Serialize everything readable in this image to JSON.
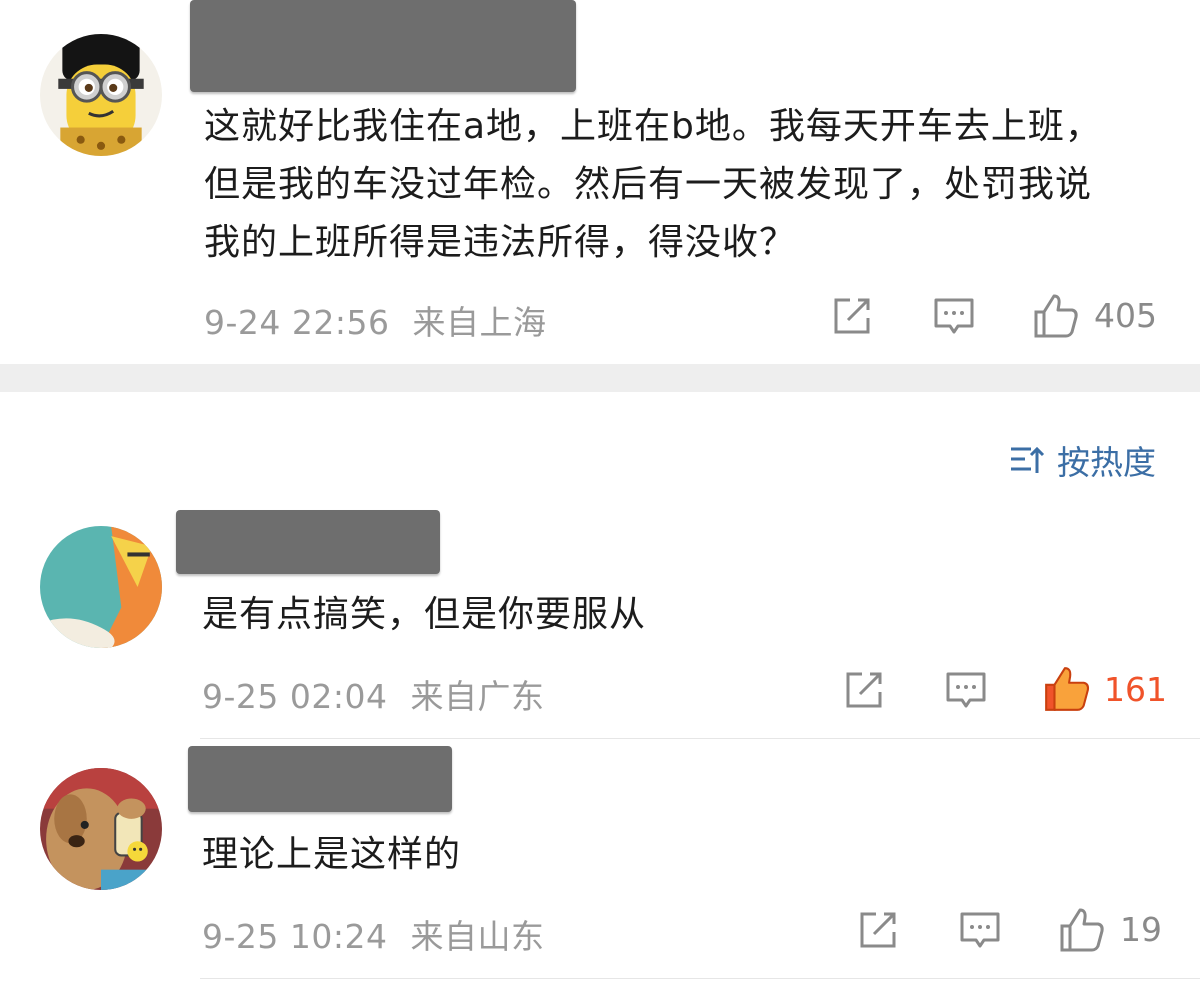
{
  "comments": [
    {
      "text": "这就好比我住在a地，上班在b地。我每天开车去上班，但是我的车没过年检。然后有一天被发现了，处罚我说我的上班所得是违法所得，得没收？",
      "time": "9-24 22:56",
      "location": "来自上海",
      "likes": "405",
      "liked": false
    },
    {
      "text": "是有点搞笑，但是你要服从",
      "time": "9-25 02:04",
      "location": "来自广东",
      "likes": "161",
      "liked": true
    },
    {
      "text": "理论上是这样的",
      "time": "9-25 10:24",
      "location": "来自山东",
      "likes": "19",
      "liked": false
    }
  ],
  "sort": {
    "label": "按热度",
    "icon": "sort-icon"
  },
  "colors": {
    "accent_link": "#3b6ea5",
    "like_active": "#f0532a",
    "meta_gray": "#9a9a9a"
  },
  "icons": [
    "share-icon",
    "comment-icon",
    "thumbs-up-icon"
  ]
}
